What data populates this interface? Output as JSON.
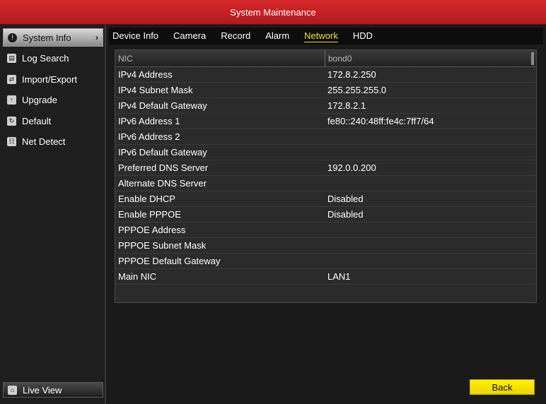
{
  "window": {
    "title": "System Maintenance"
  },
  "sidebar": {
    "items": [
      {
        "label": "System Info",
        "icon": "info-icon",
        "active": true
      },
      {
        "label": "Log Search",
        "icon": "log-search-icon"
      },
      {
        "label": "Import/Export",
        "icon": "import-export-icon"
      },
      {
        "label": "Upgrade",
        "icon": "upgrade-icon"
      },
      {
        "label": "Default",
        "icon": "default-icon"
      },
      {
        "label": "Net Detect",
        "icon": "net-detect-icon"
      }
    ],
    "live_view": {
      "label": "Live View",
      "icon": "home-icon"
    }
  },
  "tabs": [
    {
      "label": "Device Info"
    },
    {
      "label": "Camera"
    },
    {
      "label": "Record"
    },
    {
      "label": "Alarm"
    },
    {
      "label": "Network",
      "active": true
    },
    {
      "label": "HDD"
    }
  ],
  "table": {
    "header": {
      "col1": "NIC",
      "col2": "bond0"
    },
    "rows": [
      {
        "key": "IPv4 Address",
        "value": "172.8.2.250"
      },
      {
        "key": "IPv4 Subnet Mask",
        "value": "255.255.255.0"
      },
      {
        "key": "IPv4 Default Gateway",
        "value": "172.8.2.1"
      },
      {
        "key": "IPv6 Address 1",
        "value": "fe80::240:48ff:fe4c:7ff7/64"
      },
      {
        "key": "IPv6 Address 2",
        "value": ""
      },
      {
        "key": "IPv6 Default Gateway",
        "value": ""
      },
      {
        "key": "Preferred DNS Server",
        "value": "192.0.0.200"
      },
      {
        "key": "Alternate DNS Server",
        "value": ""
      },
      {
        "key": "Enable DHCP",
        "value": "Disabled"
      },
      {
        "key": "Enable PPPOE",
        "value": "Disabled"
      },
      {
        "key": "PPPOE Address",
        "value": ""
      },
      {
        "key": "PPPOE Subnet Mask",
        "value": ""
      },
      {
        "key": "PPPOE Default Gateway",
        "value": ""
      },
      {
        "key": "Main NIC",
        "value": "LAN1"
      }
    ]
  },
  "footer": {
    "back_label": "Back"
  },
  "colors": {
    "title_bar": "#c8202a",
    "active_tab": "#f0e31a",
    "back_button": "#f5e600"
  }
}
